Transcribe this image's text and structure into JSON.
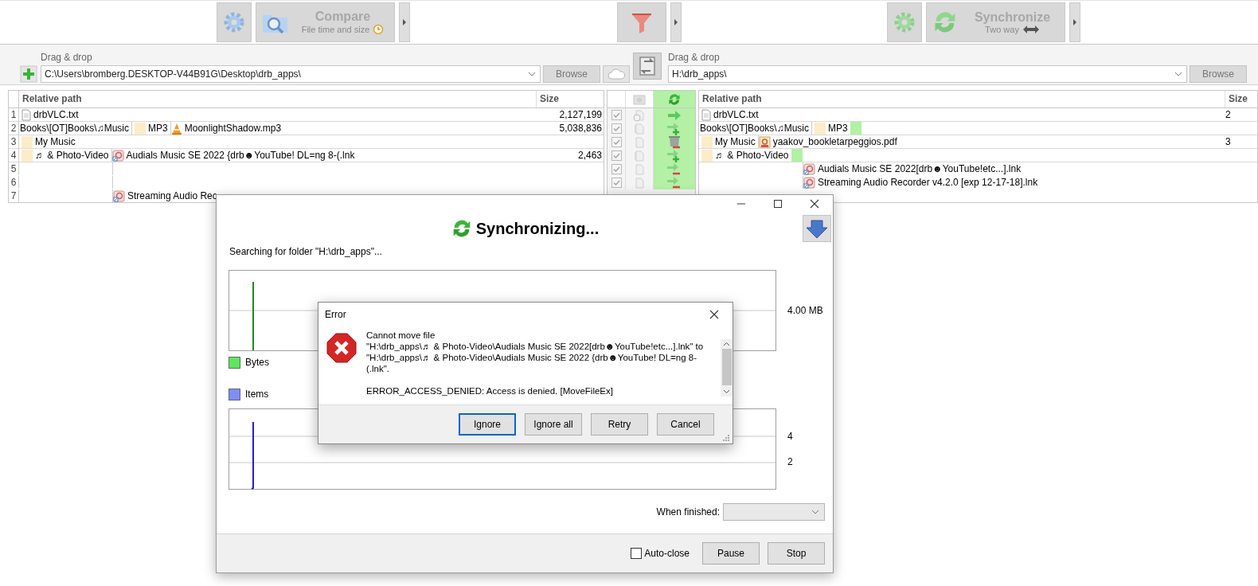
{
  "toolbar": {
    "compare": {
      "label": "Compare",
      "sublabel": "File time and size"
    },
    "synchronize": {
      "label": "Synchronize",
      "sublabel": "Two way"
    }
  },
  "folder_pairs": {
    "left": {
      "caption": "Drag & drop",
      "path": "C:\\Users\\bromberg.DESKTOP-V44B91G\\Desktop\\drb_apps\\",
      "button": "Browse"
    },
    "right": {
      "caption": "Drag & drop",
      "path": "H:\\drb_apps\\",
      "button": "Browse"
    }
  },
  "left_grid": {
    "columns": [
      "Relative path",
      "Size"
    ],
    "rows": [
      {
        "num": "1",
        "parts": [
          {
            "kind": "file",
            "text": "drbVLC.txt"
          }
        ],
        "size": "2,127,199"
      },
      {
        "num": "2",
        "parts": [
          {
            "kind": "plain",
            "text": "Books\\[OT]Books\\♫Music"
          },
          {
            "kind": "folder",
            "text": "MP3"
          },
          {
            "kind": "media",
            "text": "MoonlightShadow.mp3"
          }
        ],
        "size": "5,038,836"
      },
      {
        "num": "3",
        "parts": [
          {
            "kind": "folder",
            "text": "My Music"
          }
        ]
      },
      {
        "num": "4",
        "parts": [
          {
            "kind": "folder",
            "text": "♬ & Photo-Video"
          },
          {
            "kind": "shortcut",
            "text": "Audials Music SE 2022 {drb☻YouTube! DL=ng 8-(.lnk"
          }
        ],
        "size": "2,463"
      },
      {
        "num": "5",
        "continues": true
      },
      {
        "num": "6",
        "continues": true
      },
      {
        "num": "7",
        "continues": true,
        "parts": [
          {
            "kind": "shortcut",
            "text": "Streaming Audio Rec"
          }
        ]
      }
    ]
  },
  "middle_grid": {
    "rows": [
      {
        "checked": true,
        "category": {
          "kind": "different"
        },
        "action": {
          "kind": "update"
        }
      },
      {
        "checked": true,
        "category": {
          "kind": "left"
        },
        "action": {
          "kind": "create"
        }
      },
      {
        "checked": true,
        "category": {
          "kind": "right"
        },
        "action": {
          "kind": "delete"
        }
      },
      {
        "checked": true,
        "category": {
          "kind": "left"
        },
        "action": {
          "kind": "create"
        }
      },
      {
        "checked": true,
        "category": {
          "kind": "right"
        },
        "action": {
          "kind": "move"
        }
      },
      {
        "checked": true,
        "category": {
          "kind": "right"
        },
        "action": {
          "kind": "move"
        }
      }
    ]
  },
  "right_grid": {
    "columns": [
      "Relative path",
      "Size"
    ],
    "rows": [
      {
        "parts": [
          {
            "kind": "file",
            "text": "drbVLC.txt"
          }
        ],
        "size": "2"
      },
      {
        "parts": [
          {
            "kind": "plain",
            "text": "Books\\[OT]Books\\♫Music"
          },
          {
            "kind": "folder",
            "text": "MP3",
            "pending": true
          }
        ]
      },
      {
        "parts": [
          {
            "kind": "folder",
            "text": "My Music"
          },
          {
            "kind": "pdf",
            "text": "yaakov_bookletarpeggios.pdf"
          }
        ],
        "size": "3"
      },
      {
        "parts": [
          {
            "kind": "folder",
            "text": "♬ & Photo-Video",
            "pending": true
          }
        ]
      },
      {
        "continues": true,
        "parts": [
          {
            "kind": "shortcut",
            "text": "Audials Music SE 2022[drb☻YouTube!etc...].lnk"
          }
        ]
      },
      {
        "continues": true,
        "parts": [
          {
            "kind": "shortcut",
            "text": "Streaming Audio Recorder v4.2.0 [exp 12-17-18].lnk"
          }
        ]
      }
    ]
  },
  "sync_dialog": {
    "heading": "Synchronizing...",
    "status": "Searching for folder \"H:\\drb_apps\"...",
    "bytes_graph": {
      "label": "4.00 MB"
    },
    "legend": [
      {
        "label": "Bytes",
        "color": "#5ee65e"
      },
      {
        "label": "Items",
        "color": "#7d8ff5"
      }
    ],
    "items_graph": {
      "labels": [
        "4",
        "2"
      ]
    },
    "when_finished": {
      "label": "When finished:"
    },
    "auto_close": {
      "label": "Auto-close",
      "checked": false
    },
    "buttons": [
      "Pause",
      "Stop"
    ]
  },
  "error_dialog": {
    "title": "Error",
    "paragraphs": [
      "Cannot move file\n\"H:\\drb_apps\\♬ & Photo-Video\\Audials Music SE 2022[drb☻YouTube!etc...].lnk\" to \"H:\\drb_apps\\♬ & Photo-Video\\Audials Music SE 2022 {drb☻YouTube! DL=ng 8-(.lnk\".",
      "ERROR_ACCESS_DENIED: Access is denied. [MoveFileEx]"
    ],
    "buttons": [
      {
        "label": "Ignore",
        "default": true
      },
      {
        "label": "Ignore all",
        "default": false
      },
      {
        "label": "Retry",
        "default": false
      },
      {
        "label": "Cancel",
        "default": false
      }
    ]
  }
}
